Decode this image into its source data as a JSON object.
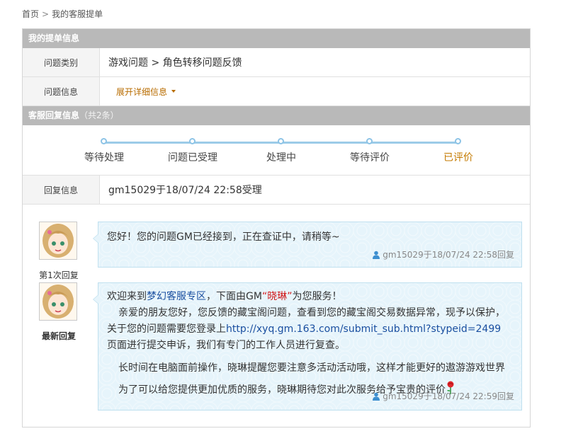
{
  "breadcrumb": {
    "home": "首页",
    "sep": ">",
    "current": "我的客服提单"
  },
  "ticket_section": {
    "title": "我的提单信息"
  },
  "ticket": {
    "category_label": "问题类别",
    "category_value": "游戏问题 > 角色转移问题反馈",
    "info_label": "问题信息",
    "expand_label": "展开详细信息"
  },
  "reply_section": {
    "title": "客服回复信息",
    "count": "（共2条）"
  },
  "progress": {
    "steps": [
      "等待处理",
      "问题已受理",
      "处理中",
      "等待评价",
      "已评价"
    ],
    "active_step": "已评价"
  },
  "reply_info": {
    "label": "回复信息",
    "value": "gm15029于18/07/24 22:58受理"
  },
  "replies": [
    {
      "avatar_label": "第1次回复",
      "text": "您好！您的问题GM已经接到，正在查证中，请稍等~",
      "meta": "gm15029于18/07/24 22:58回复"
    },
    {
      "avatar_label": "最新回复",
      "line1_a": "欢迎来到",
      "line1_b": "梦幻客服专区",
      "line1_c": "，下面由GM",
      "line1_d": "“晓琳”",
      "line1_e": "为您服务！",
      "line2": "亲爱的朋友您好，您反馈的藏宝阁问题，查看到您的藏宝阁交易数据异常，现予以保护，",
      "line3_a": "关于您的问题需要您登录上",
      "line3_link": "http://xyq.gm.163.com/submit_sub.html?stypeid=2499",
      "line4": "页面进行提交申诉，我们有专门的工作人员进行复查。",
      "line5": "长时间在电脑面前操作，晓琳提醒您要注意多活动活动哦，这样才能更好的遨游游戏世界",
      "line6": "为了可以给您提供更加优质的服务，晓琳期待您对此次服务给予宝贵的评价",
      "meta": "gm15029于18/07/24 22:59回复"
    }
  ],
  "colors": {
    "accent": "#c47a00",
    "header_gray": "#b9b9b9",
    "bubble_bg": "#e6f4fb",
    "link_blue": "#1a4fa0",
    "name_red": "#d01818"
  }
}
